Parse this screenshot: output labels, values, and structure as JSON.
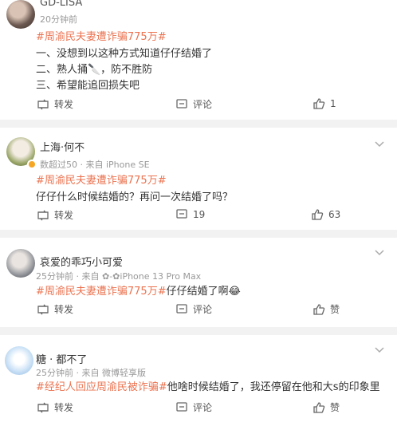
{
  "posts": [
    {
      "username": "GD-LISA",
      "meta": "20分钟前",
      "tag": "#周渝民夫妻遭诈骗775万#",
      "lines": [
        "一、没想到以这种方式知道仔仔结婚了",
        "二、熟人捅🔪，防不胜防",
        "三、希望能追回损失吧"
      ],
      "repost": "转发",
      "comment": "评论",
      "likes": "1"
    },
    {
      "username": "上海·何不",
      "meta": "数超过50 · 来自 iPhone SE",
      "tag": "#周渝民夫妻遭诈骗775万#",
      "text": "仔仔什么时候结婚的？再问一次结婚了吗？",
      "repost": "转发",
      "comment": "19",
      "likes": "63"
    },
    {
      "username": "哀爱的乖巧小可爱",
      "meta": "25分钟前 · 来自 ✿-✿iPhone 13 Pro Max",
      "tag": "#周渝民夫妻遭诈骗775万#",
      "text": "仔仔结婚了啊😂",
      "repost": "转发",
      "comment": "评论",
      "likes": "赞"
    },
    {
      "username": "糖 · 都不了",
      "meta": "25分钟前 · 来自 微博轻享版",
      "tag": "#经纪人回应周渝民被诈骗#",
      "text": "他啥时候结婚了，我还停留在他和大s的印象里",
      "repost": "转发",
      "comment": "评论",
      "likes": "赞"
    }
  ],
  "colors": {
    "tag": "#eb7350",
    "badge": "#f5a623"
  }
}
